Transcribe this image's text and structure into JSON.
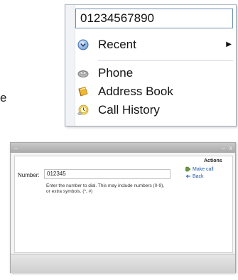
{
  "cut_text": "e",
  "menu": {
    "number_value": "01234567890",
    "items": [
      {
        "label": "Recent",
        "icon": "recent-chevron-icon",
        "has_submenu": true
      },
      {
        "label": "Phone",
        "icon": "phone-icon"
      },
      {
        "label": "Address Book",
        "icon": "address-book-icon"
      },
      {
        "label": "Call History",
        "icon": "call-history-icon"
      }
    ],
    "submenu_arrow": "▶"
  },
  "dialog": {
    "close_glyph": "x",
    "number_label": "Number:",
    "number_value": "012345",
    "help_text": "Enter the number to dial. This may include numbers (0-9), or extra symbols. (*, #)",
    "actions_heading": "Actions",
    "actions": [
      {
        "label": "Make call",
        "icon": "make-call-icon"
      },
      {
        "label": "Back",
        "icon": "back-arrow-icon"
      }
    ]
  },
  "colors": {
    "field_border": "#6c8fb3",
    "action_link": "#1b5aa8"
  }
}
